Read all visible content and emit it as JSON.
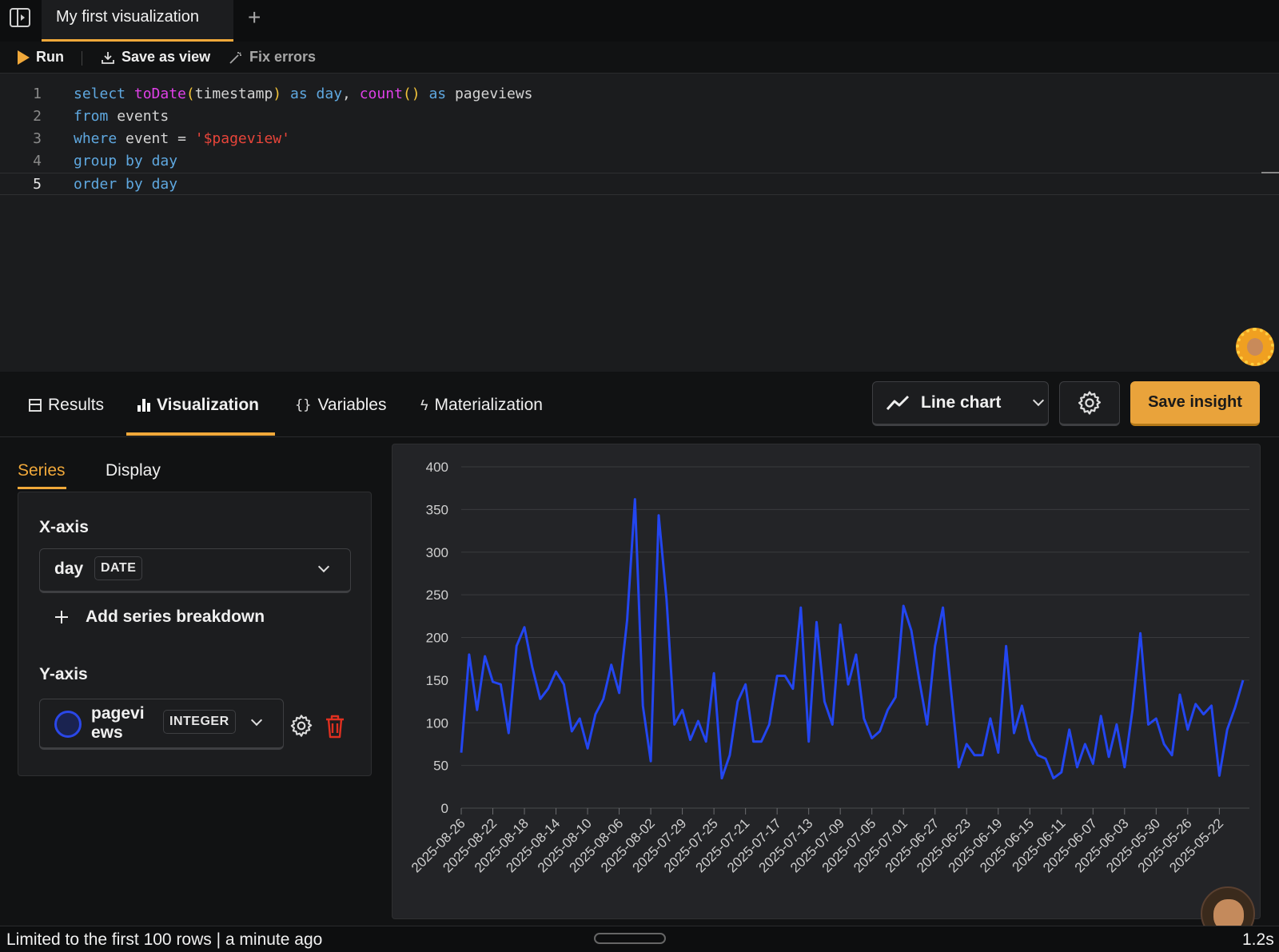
{
  "tabs": {
    "active_label": "My first visualization",
    "add_label": "+"
  },
  "toolbar": {
    "run_label": "Run",
    "save_view_label": "Save as view",
    "fix_errors_label": "Fix errors"
  },
  "editor": {
    "lines": [
      {
        "num": "1"
      },
      {
        "num": "2"
      },
      {
        "num": "3"
      },
      {
        "num": "4"
      },
      {
        "num": "5"
      }
    ],
    "tokens": {
      "l1_select": "select",
      "l1_fn1": "toDate",
      "l1_p1": "(",
      "l1_arg": "timestamp",
      "l1_p2": ")",
      "l1_as1": "as",
      "l1_day": "day",
      "l1_comma": ",",
      "l1_fn2": "count",
      "l1_p3": "()",
      "l1_as2": "as",
      "l1_pv": "pageviews",
      "l2_from": "from",
      "l2_tbl": "events",
      "l3_where": "where",
      "l3_col": "event",
      "l3_eq": "=",
      "l3_str": "'$pageview'",
      "l4_group": "group",
      "l4_by": "by",
      "l4_day": "day",
      "l5_order": "order",
      "l5_by": "by",
      "l5_day": "day"
    }
  },
  "lower_tabs": {
    "results": "Results",
    "visualization": "Visualization",
    "variables": "Variables",
    "materialization": "Materialization",
    "chart_type": "Line chart",
    "save_insight": "Save insight"
  },
  "panel": {
    "tab_series": "Series",
    "tab_display": "Display",
    "x_axis_label": "X-axis",
    "x_field": "day",
    "x_type": "DATE",
    "add_breakdown": "Add series breakdown",
    "y_axis_label": "Y-axis",
    "y_field_line1": "pagevi",
    "y_field_line2": "ews",
    "y_type": "INTEGER"
  },
  "status": {
    "text": "Limited to the first 100 rows  |  a minute ago",
    "timing": "1.2s"
  },
  "colors": {
    "accent": "#f0a83a",
    "series": "#2346f0",
    "danger": "#e03020"
  },
  "icons": [
    "sidebar-toggle-icon",
    "play-icon",
    "download-icon",
    "magic-wand-icon",
    "table-icon",
    "bar-chart-icon",
    "braces-icon",
    "bolt-icon",
    "line-chart-icon",
    "chevron-down-icon",
    "gear-icon",
    "plus-icon",
    "trash-icon"
  ],
  "chart_data": {
    "type": "line",
    "ylim": [
      0,
      400
    ],
    "yticks": [
      "0",
      "50",
      "100",
      "150",
      "200",
      "250",
      "300",
      "350",
      "400"
    ],
    "xticks": [
      "2025-08-26",
      "2025-08-22",
      "2025-08-18",
      "2025-08-14",
      "2025-08-10",
      "2025-08-06",
      "2025-08-02",
      "2025-07-29",
      "2025-07-25",
      "2025-07-21",
      "2025-07-17",
      "2025-07-13",
      "2025-07-09",
      "2025-07-05",
      "2025-07-01",
      "2025-06-27",
      "2025-06-23",
      "2025-06-19",
      "2025-06-15",
      "2025-06-11",
      "2025-06-07",
      "2025-06-03",
      "2025-05-30",
      "2025-05-26",
      "2025-05-22"
    ],
    "series": [
      {
        "values": [
          65,
          180,
          115,
          178,
          148,
          145,
          88,
          190,
          212,
          165,
          128,
          140,
          160,
          145,
          90,
          105,
          70,
          110,
          128,
          168,
          135,
          220,
          362,
          120,
          55,
          343,
          245,
          98,
          115,
          80,
          102,
          78,
          158,
          35,
          62,
          125,
          145,
          78,
          78,
          98,
          155,
          155,
          140,
          235,
          78,
          218,
          125,
          98,
          215,
          145,
          180,
          105,
          82,
          90,
          115,
          130,
          237,
          208,
          150,
          98,
          190,
          235,
          140,
          48,
          75,
          62,
          62,
          105,
          65,
          190,
          88,
          120,
          80,
          62,
          58,
          35,
          42,
          92,
          48,
          75,
          52,
          108,
          60,
          98,
          48,
          115,
          205,
          98,
          105,
          75,
          62,
          133,
          92,
          122,
          110,
          120,
          38,
          92,
          118,
          150
        ]
      }
    ]
  }
}
